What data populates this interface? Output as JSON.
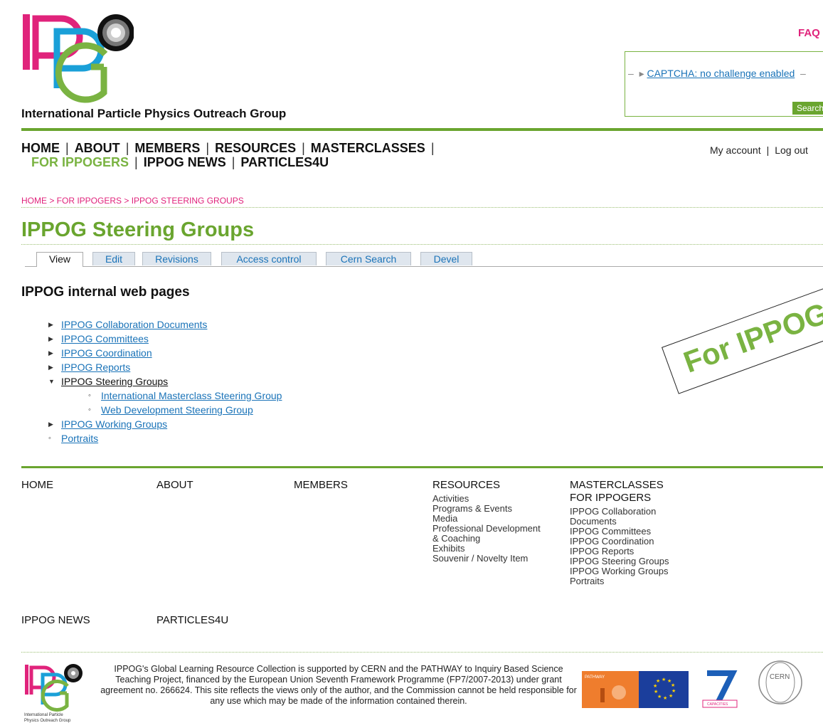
{
  "header": {
    "site_name": "International Particle Physics Outreach Group",
    "faq": "FAQ",
    "captcha_link": "CAPTCHA: no challenge enabled",
    "search_button": "Search"
  },
  "nav": {
    "row1": [
      "HOME",
      "ABOUT",
      "MEMBERS",
      "RESOURCES",
      "MASTERCLASSES"
    ],
    "row2": [
      "FOR IPPOGERS",
      "IPPOG NEWS",
      "PARTICLES4U"
    ],
    "active": "FOR IPPOGERS",
    "account": "My account",
    "logout": "Log out"
  },
  "breadcrumb": "HOME > FOR IPPOGERS > IPPOG STEERING GROUPS",
  "page_title": "IPPOG Steering Groups",
  "tabs": [
    "View",
    "Edit",
    "Revisions",
    "Access control",
    "Cern Search",
    "Devel"
  ],
  "section_heading": "IPPOG internal web pages",
  "tree": [
    {
      "label": "IPPOG Collaboration Documents",
      "link": true
    },
    {
      "label": "IPPOG Committees",
      "link": true
    },
    {
      "label": "IPPOG Coordination",
      "link": true
    },
    {
      "label": "IPPOG Reports",
      "link": true
    },
    {
      "label": "IPPOG Steering Groups",
      "link": false,
      "expanded": true,
      "children": [
        "International Masterclass Steering Group",
        "Web Development Steering Group"
      ]
    },
    {
      "label": "IPPOG Working Groups",
      "link": true
    },
    {
      "label": "Portraits",
      "link": true,
      "leaf": true
    }
  ],
  "stamp": "For IPPOGers",
  "footer": {
    "home": "HOME",
    "about": "ABOUT",
    "members": "MEMBERS",
    "resources": "RESOURCES",
    "resources_items": [
      "Activities",
      "Programs & Events",
      "Media",
      "Professional Development",
      "& Coaching",
      "Exhibits",
      "Souvenir / Novelty Item"
    ],
    "masterclasses": "MASTERCLASSES",
    "for_ippogers": "FOR IPPOGERS",
    "ippogers_items": [
      "IPPOG Collaboration",
      "Documents",
      "IPPOG Committees",
      "IPPOG Coordination",
      "IPPOG Reports",
      "IPPOG Steering Groups",
      "IPPOG Working Groups",
      "Portraits"
    ],
    "ippog_news": "IPPOG NEWS",
    "particles4u": "PARTICLES4U",
    "text": "IPPOG's Global Learning Resource Collection is supported by CERN and the PATHWAY to Inquiry Based Science Teaching Project, financed by the European Union Seventh Framework Programme (FP7/2007-2013) under grant agreement no. 266624. This site reflects the views only of the author, and the Commission cannot be held responsible for any use which may be made of the information contained therein.",
    "logo_caption": "International Particle Physics Outreach Group",
    "pathway_label": "PATHWAY",
    "fp7_label": "CAPACITIES",
    "cern_label": "CERN"
  },
  "colors": {
    "green": "#6aa52f",
    "magenta": "#e0237b",
    "link": "#1a73b8"
  }
}
